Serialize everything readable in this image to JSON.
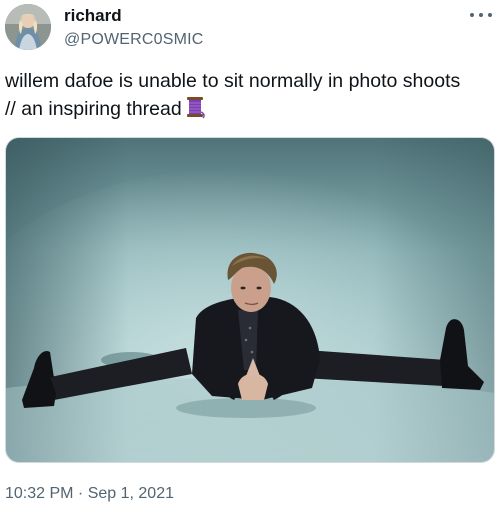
{
  "user": {
    "display_name": "richard",
    "handle": "@POWERC0SMIC"
  },
  "tweet": {
    "text_line1": "willem dafoe is unable to sit normally in photo shoots",
    "text_line2": "// an inspiring thread",
    "emoji_icon": "thread-spool-icon",
    "timestamp": "10:32 PM · Sep 1, 2021"
  },
  "icons": {
    "more": "more-options-icon"
  },
  "colors": {
    "text_primary": "#0f1419",
    "text_secondary": "#536471",
    "photo_backdrop": "#9fc3c6"
  }
}
